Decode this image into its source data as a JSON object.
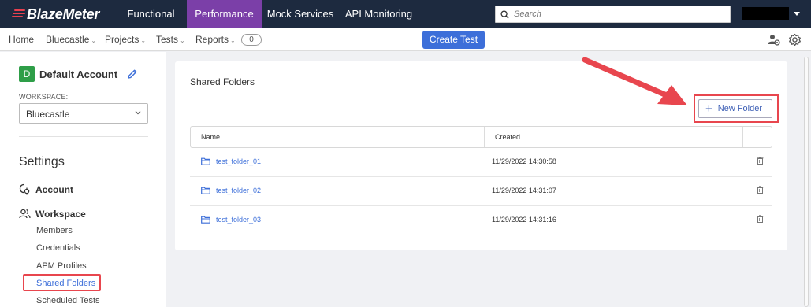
{
  "app": {
    "brand": "BlazeMeter"
  },
  "topnav": {
    "tabs": [
      {
        "label": "Functional"
      },
      {
        "label": "Performance",
        "active": true
      },
      {
        "label": "Mock Services"
      },
      {
        "label": "API Monitoring"
      }
    ],
    "search_placeholder": "Search"
  },
  "subnav": {
    "items": [
      {
        "label": "Home"
      },
      {
        "label": "Bluecastle"
      },
      {
        "label": "Projects"
      },
      {
        "label": "Tests"
      },
      {
        "label": "Reports"
      }
    ],
    "reports_count": "0",
    "create_test": "Create Test"
  },
  "sidebar": {
    "account_initial": "D",
    "account_name": "Default Account",
    "workspace_label": "WORKSPACE:",
    "workspace_value": "Bluecastle",
    "settings_heading": "Settings",
    "account_section": "Account",
    "workspace_section": "Workspace",
    "links": [
      "Members",
      "Credentials",
      "APM Profiles",
      "Shared Folders",
      "Scheduled Tests"
    ]
  },
  "main": {
    "title": "Shared Folders",
    "new_folder": "New Folder",
    "columns": [
      "Name",
      "Created"
    ],
    "rows": [
      {
        "name": "test_folder_01",
        "created": "11/29/2022 14:30:58"
      },
      {
        "name": "test_folder_02",
        "created": "11/29/2022 14:31:07"
      },
      {
        "name": "test_folder_03",
        "created": "11/29/2022 14:31:16"
      }
    ]
  },
  "colors": {
    "topbar": "#1d2a3f",
    "active_tab": "#7b3fa8",
    "primary": "#3d6fd9",
    "highlight": "#e8464e",
    "avatar": "#2e9e48"
  }
}
